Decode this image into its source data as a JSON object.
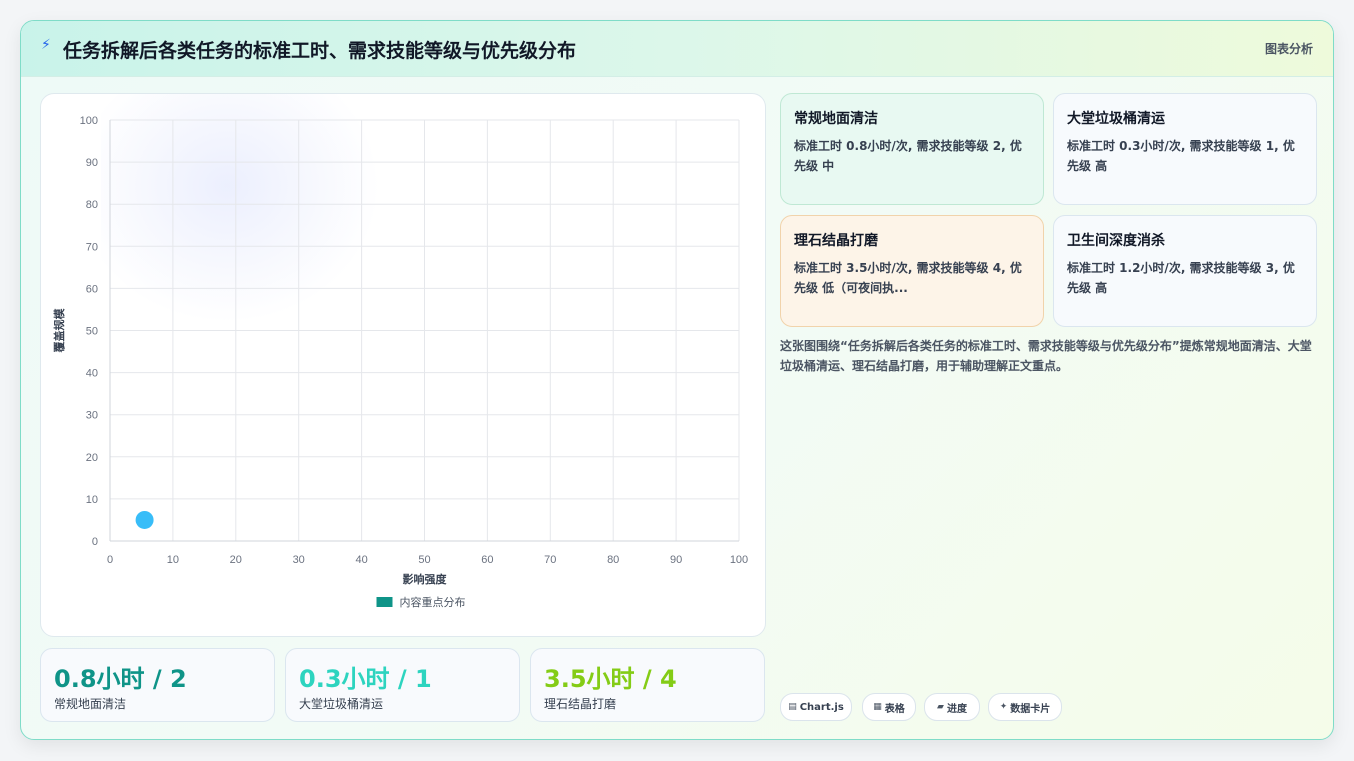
{
  "header": {
    "title": "任务拆解后各类任务的标准工时、需求技能等级与优先级分布",
    "tag": "图表分析"
  },
  "colors": {
    "accent": "#0f9488",
    "point": "#38bdf8",
    "stat1": "#0f9488",
    "stat2": "#2dd4bf",
    "stat3": "#84cc16"
  },
  "chart_data": {
    "type": "scatter",
    "xlabel": "影响强度",
    "ylabel": "覆盖规模",
    "xlim": [
      0,
      100
    ],
    "ylim": [
      0,
      100
    ],
    "xticks": [
      0,
      10,
      20,
      30,
      40,
      50,
      60,
      70,
      80,
      90,
      100
    ],
    "yticks": [
      0,
      10,
      20,
      30,
      40,
      50,
      60,
      70,
      80,
      90,
      100
    ],
    "grid": true,
    "legend_position": "bottom",
    "series": [
      {
        "name": "内容重点分布",
        "color": "#0f9488",
        "point_color": "#38bdf8",
        "points": [
          {
            "x": 5.5,
            "y": 5
          }
        ]
      }
    ]
  },
  "info_cards": [
    {
      "title": "常规地面清洁",
      "desc": "标准工时 0.8小时/次, 需求技能等级 2, 优先级 中",
      "style": "green"
    },
    {
      "title": "大堂垃圾桶清运",
      "desc": "标准工时 0.3小时/次, 需求技能等级 1, 优先级 高",
      "style": "plain"
    },
    {
      "title": "理石结晶打磨",
      "desc": "标准工时 3.5小时/次, 需求技能等级 4, 优先级 低（可夜间执...",
      "style": "orange"
    },
    {
      "title": "卫生间深度消杀",
      "desc": "标准工时 1.2小时/次, 需求技能等级 3, 优先级 高",
      "style": "plain"
    }
  ],
  "summary": "这张图围绕“任务拆解后各类任务的标准工时、需求技能等级与优先级分布”提炼常规地面清洁、大堂垃圾桶清运、理石结晶打磨，用于辅助理解正文重点。",
  "stats": [
    {
      "value": "0.8小时 / 2",
      "label": "常规地面清洁"
    },
    {
      "value": "0.3小时 / 1",
      "label": "大堂垃圾桶清运"
    },
    {
      "value": "3.5小时 / 4",
      "label": "理石结晶打磨"
    }
  ],
  "chips": [
    {
      "icon": "▤",
      "icon_name": "chart-icon",
      "label": "Chart.js"
    },
    {
      "icon": "▦",
      "icon_name": "table-icon",
      "label": "表格"
    },
    {
      "icon": "▰",
      "icon_name": "progress-icon",
      "label": "进度"
    },
    {
      "icon": "✦",
      "icon_name": "sparkle-icon",
      "label": "数据卡片"
    }
  ]
}
